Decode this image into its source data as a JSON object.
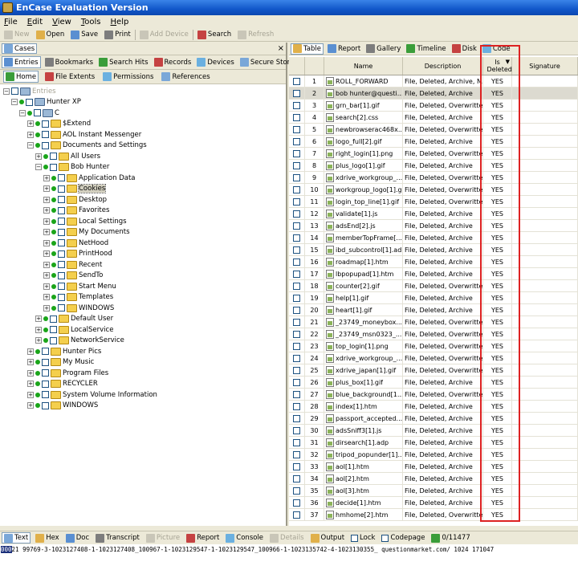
{
  "app": {
    "title": "EnCase Evaluation Version"
  },
  "menu": [
    "File",
    "Edit",
    "View",
    "Tools",
    "Help"
  ],
  "toolbar": [
    {
      "label": "New",
      "disabled": true,
      "icon": "new-icon"
    },
    {
      "label": "Open",
      "disabled": false,
      "icon": "open-icon"
    },
    {
      "label": "Save",
      "disabled": false,
      "icon": "save-icon"
    },
    {
      "label": "Print",
      "disabled": false,
      "icon": "print-icon"
    },
    {
      "label": "Add Device",
      "disabled": true,
      "icon": "add-device-icon"
    },
    {
      "label": "Search",
      "disabled": false,
      "icon": "search-icon"
    },
    {
      "label": "Refresh",
      "disabled": true,
      "icon": "refresh-icon"
    }
  ],
  "left": {
    "cases_tab": "Cases",
    "tabs": [
      "Entries",
      "Bookmarks",
      "Search Hits",
      "Records",
      "Devices",
      "Secure Storage"
    ],
    "subtabs": [
      "Home",
      "File Extents",
      "Permissions",
      "References"
    ],
    "tree": [
      {
        "label": "Entries",
        "depth": 0,
        "disabled": true
      },
      {
        "label": "Hunter XP",
        "depth": 1
      },
      {
        "label": "C",
        "depth": 2
      },
      {
        "label": "$Extend",
        "depth": 3
      },
      {
        "label": "AOL Instant Messenger",
        "depth": 3
      },
      {
        "label": "Documents and Settings",
        "depth": 3
      },
      {
        "label": "All Users",
        "depth": 4
      },
      {
        "label": "Bob Hunter",
        "depth": 4
      },
      {
        "label": "Application Data",
        "depth": 5
      },
      {
        "label": "Cookies",
        "depth": 5,
        "selected": true
      },
      {
        "label": "Desktop",
        "depth": 5
      },
      {
        "label": "Favorites",
        "depth": 5
      },
      {
        "label": "Local Settings",
        "depth": 5
      },
      {
        "label": "My Documents",
        "depth": 5
      },
      {
        "label": "NetHood",
        "depth": 5
      },
      {
        "label": "PrintHood",
        "depth": 5
      },
      {
        "label": "Recent",
        "depth": 5
      },
      {
        "label": "SendTo",
        "depth": 5
      },
      {
        "label": "Start Menu",
        "depth": 5
      },
      {
        "label": "Templates",
        "depth": 5
      },
      {
        "label": "WINDOWS",
        "depth": 5
      },
      {
        "label": "Default User",
        "depth": 4
      },
      {
        "label": "LocalService",
        "depth": 4
      },
      {
        "label": "NetworkService",
        "depth": 4
      },
      {
        "label": "Hunter Pics",
        "depth": 3
      },
      {
        "label": "My Music",
        "depth": 3
      },
      {
        "label": "Program Files",
        "depth": 3
      },
      {
        "label": "RECYCLER",
        "depth": 3
      },
      {
        "label": "System Volume Information",
        "depth": 3
      },
      {
        "label": "WINDOWS",
        "depth": 3
      }
    ]
  },
  "right": {
    "tabs": [
      "Table",
      "Report",
      "Gallery",
      "Timeline",
      "Disk",
      "Code"
    ],
    "columns": {
      "name": "Name",
      "description": "Description",
      "is_deleted": "Is Deleted",
      "signature": "Signature"
    },
    "rows": [
      {
        "n": "1",
        "name": "ROLL_FORWARD",
        "desc": "File, Deleted, Archive, N...",
        "del": "YES"
      },
      {
        "n": "2",
        "name": "bob hunter@questi...",
        "desc": "File, Deleted, Archive",
        "del": "YES",
        "selected": true
      },
      {
        "n": "3",
        "name": "grn_bar[1].gif",
        "desc": "File, Deleted, Overwritte...",
        "del": "YES"
      },
      {
        "n": "4",
        "name": "search[2].css",
        "desc": "File, Deleted, Archive",
        "del": "YES"
      },
      {
        "n": "5",
        "name": "newbrowserac468x...",
        "desc": "File, Deleted, Overwritte...",
        "del": "YES"
      },
      {
        "n": "6",
        "name": "logo_full[2].gif",
        "desc": "File, Deleted, Archive",
        "del": "YES"
      },
      {
        "n": "7",
        "name": "right_login[1].png",
        "desc": "File, Deleted, Overwritte...",
        "del": "YES"
      },
      {
        "n": "8",
        "name": "plus_logo[1].gif",
        "desc": "File, Deleted, Archive",
        "del": "YES"
      },
      {
        "n": "9",
        "name": "xdrive_workgroup_...",
        "desc": "File, Deleted, Overwritte...",
        "del": "YES"
      },
      {
        "n": "10",
        "name": "workgroup_logo[1].gif",
        "desc": "File, Deleted, Overwritte...",
        "del": "YES"
      },
      {
        "n": "11",
        "name": "login_top_line[1].gif",
        "desc": "File, Deleted, Overwritte...",
        "del": "YES"
      },
      {
        "n": "12",
        "name": "validate[1].js",
        "desc": "File, Deleted, Archive",
        "del": "YES"
      },
      {
        "n": "13",
        "name": "adsEnd[2].js",
        "desc": "File, Deleted, Archive",
        "del": "YES"
      },
      {
        "n": "14",
        "name": "memberTopFrame[...",
        "desc": "File, Deleted, Archive",
        "del": "YES"
      },
      {
        "n": "15",
        "name": "ibd_subcontrol[1].adp",
        "desc": "File, Deleted, Archive",
        "del": "YES"
      },
      {
        "n": "16",
        "name": "roadmap[1].htm",
        "desc": "File, Deleted, Archive",
        "del": "YES"
      },
      {
        "n": "17",
        "name": "lbpopupad[1].htm",
        "desc": "File, Deleted, Archive",
        "del": "YES"
      },
      {
        "n": "18",
        "name": "counter[2].gif",
        "desc": "File, Deleted, Overwritte...",
        "del": "YES"
      },
      {
        "n": "19",
        "name": "help[1].gif",
        "desc": "File, Deleted, Archive",
        "del": "YES"
      },
      {
        "n": "20",
        "name": "heart[1].gif",
        "desc": "File, Deleted, Archive",
        "del": "YES"
      },
      {
        "n": "21",
        "name": "_23749_moneybox...",
        "desc": "File, Deleted, Overwritte...",
        "del": "YES"
      },
      {
        "n": "22",
        "name": "_23749_msn0323_...",
        "desc": "File, Deleted, Overwritte...",
        "del": "YES"
      },
      {
        "n": "23",
        "name": "top_login[1].png",
        "desc": "File, Deleted, Overwritte...",
        "del": "YES"
      },
      {
        "n": "24",
        "name": "xdrive_workgroup_...",
        "desc": "File, Deleted, Overwritte...",
        "del": "YES"
      },
      {
        "n": "25",
        "name": "xdrive_japan[1].gif",
        "desc": "File, Deleted, Overwritte...",
        "del": "YES"
      },
      {
        "n": "26",
        "name": "plus_box[1].gif",
        "desc": "File, Deleted, Archive",
        "del": "YES"
      },
      {
        "n": "27",
        "name": "blue_background[1...",
        "desc": "File, Deleted, Overwritte...",
        "del": "YES"
      },
      {
        "n": "28",
        "name": "index[1].htm",
        "desc": "File, Deleted, Archive",
        "del": "YES"
      },
      {
        "n": "29",
        "name": "passport_accepted...",
        "desc": "File, Deleted, Archive",
        "del": "YES"
      },
      {
        "n": "30",
        "name": "adsSniff3[1].js",
        "desc": "File, Deleted, Archive",
        "del": "YES"
      },
      {
        "n": "31",
        "name": "dirsearch[1].adp",
        "desc": "File, Deleted, Archive",
        "del": "YES"
      },
      {
        "n": "32",
        "name": "tripod_popunder[1]...",
        "desc": "File, Deleted, Archive",
        "del": "YES"
      },
      {
        "n": "33",
        "name": "aol[1].htm",
        "desc": "File, Deleted, Archive",
        "del": "YES"
      },
      {
        "n": "34",
        "name": "aol[2].htm",
        "desc": "File, Deleted, Archive",
        "del": "YES"
      },
      {
        "n": "35",
        "name": "aol[3].htm",
        "desc": "File, Deleted, Archive",
        "del": "YES"
      },
      {
        "n": "36",
        "name": "decide[1].htm",
        "desc": "File, Deleted, Archive",
        "del": "YES"
      },
      {
        "n": "37",
        "name": "hmhome[2].htm",
        "desc": "File, Deleted, Overwritte...",
        "del": "YES"
      }
    ]
  },
  "bottom": {
    "tabs": [
      {
        "label": "Text",
        "active": true
      },
      {
        "label": "Hex"
      },
      {
        "label": "Doc"
      },
      {
        "label": "Transcript"
      },
      {
        "label": "Picture",
        "disabled": true
      },
      {
        "label": "Report"
      },
      {
        "label": "Console"
      },
      {
        "label": "Details",
        "disabled": true
      },
      {
        "label": "Output"
      },
      {
        "label": "Lock"
      },
      {
        "label": "Codepage"
      },
      {
        "label": "0/11477"
      }
    ],
    "text_highlight": "000",
    "text": "21 99769-3-1023127408-1-1023127408_100967-1-1023129547-1-1023129547_100966-1-1023135742-4-1023130355_ questionmarket.com/ 1024 171047"
  }
}
